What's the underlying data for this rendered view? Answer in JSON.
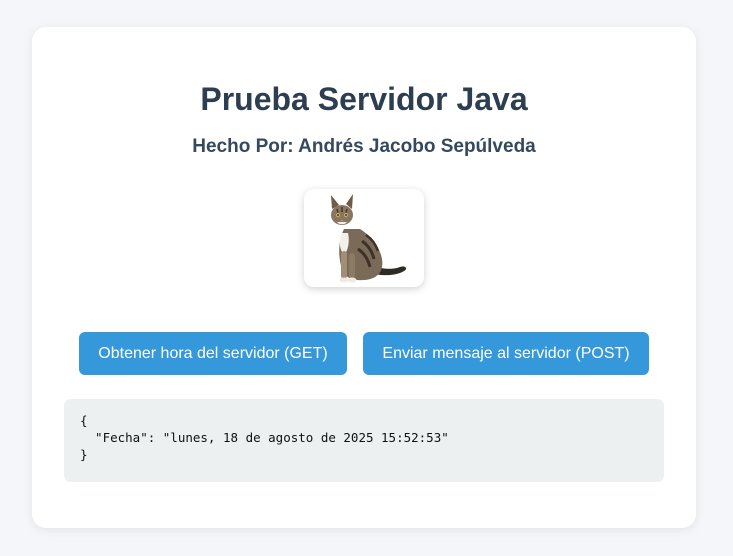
{
  "page": {
    "title": "Prueba Servidor Java",
    "subtitle": "Hecho Por: Andrés Jacobo Sepúlveda",
    "image": {
      "icon": "cat-photo",
      "description_alt": "cat"
    }
  },
  "actions": {
    "get_label": "Obtener hora del servidor (GET)",
    "post_label": "Enviar mensaje al servidor (POST)"
  },
  "output": {
    "text": "{\n  \"Fecha\": \"lunes, 18 de agosto de 2025 15:52:53\"\n}"
  },
  "colors": {
    "background": "#f4f6f9",
    "card": "#ffffff",
    "title": "#2c3e50",
    "button": "#3498db",
    "output_bg": "#ecf0f1"
  }
}
